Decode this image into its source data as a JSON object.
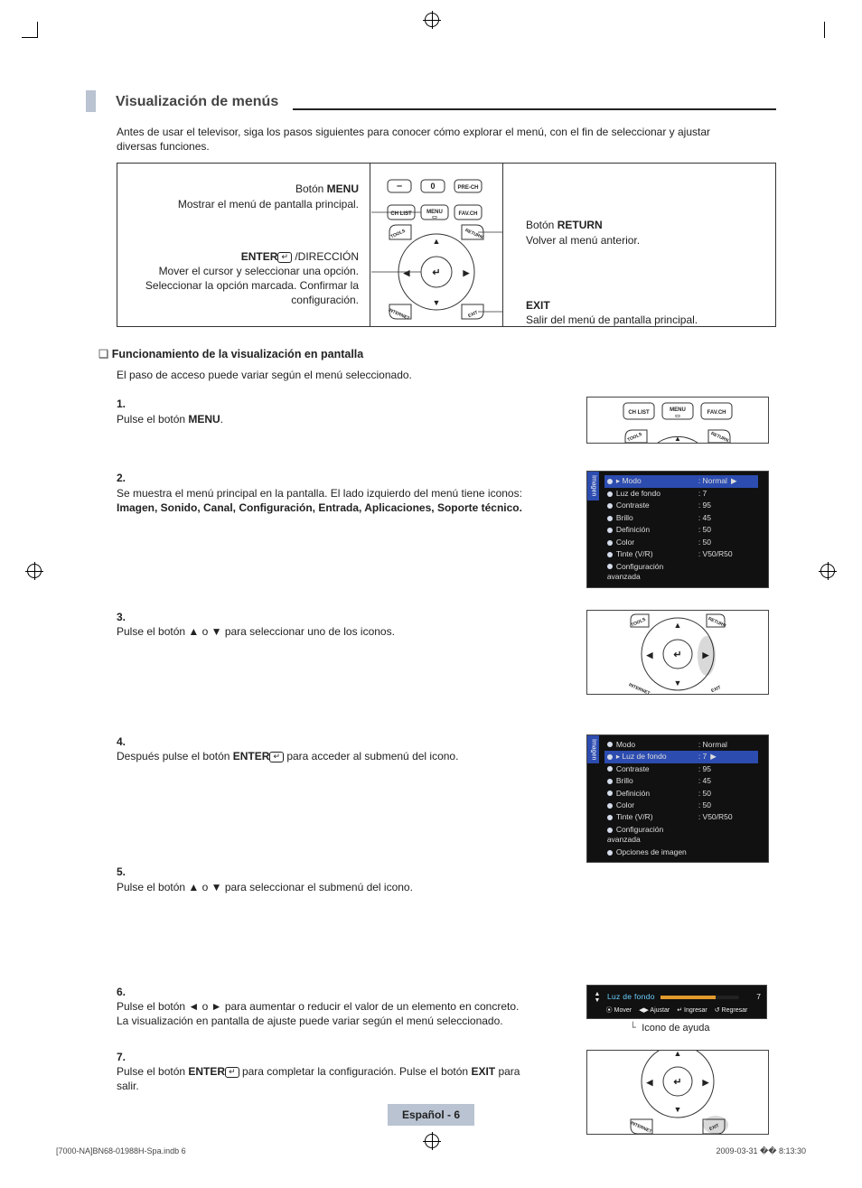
{
  "heading": "Visualización de menús",
  "intro": "Antes de usar el televisor, siga los pasos siguientes para conocer cómo explorar el menú, con el fin de seleccionar y ajustar diversas funciones.",
  "diagram": {
    "menu_btn_label_pre": "Botón ",
    "menu_btn_label_bold": "MENU",
    "menu_btn_desc": "Mostrar el menú de pantalla principal.",
    "enter_label_bold": "ENTER",
    "enter_label_post": " /DIRECCIÓN",
    "enter_desc": "Mover el cursor y seleccionar una opción. Seleccionar la opción marcada. Confirmar la configuración.",
    "return_label_pre": "Botón ",
    "return_label_bold": "RETURN",
    "return_desc": "Volver al menú anterior.",
    "exit_label_bold": "EXIT",
    "exit_desc": "Salir del menú de pantalla principal.",
    "remote_buttons": {
      "minus": "–",
      "zero": "0",
      "prech": "PRE-CH",
      "chlist": "CH LIST",
      "menu": "MENU",
      "favch": "FAV.CH",
      "tools": "TOOLS",
      "return": "RETURN",
      "internet": "INTERNET",
      "exit": "EXIT"
    }
  },
  "sub_heading": "Funcionamiento de la visualización en pantalla",
  "sub_intro": "El paso de acceso puede variar según el menú seleccionado.",
  "steps": {
    "s1": {
      "num": "1.",
      "text_pre": "Pulse el botón ",
      "text_bold": "MENU",
      "text_post": "."
    },
    "s2": {
      "num": "2.",
      "text_a": "Se muestra el menú principal en la pantalla. El lado izquierdo del menú tiene iconos:",
      "text_b_bold": "Imagen, Sonido, Canal, Configuración, Entrada, Aplicaciones, Soporte técnico."
    },
    "s3": {
      "num": "3.",
      "text": "Pulse el botón ▲ o ▼ para seleccionar uno de los iconos."
    },
    "s4": {
      "num": "4.",
      "text_pre": "Después pulse el botón ",
      "text_bold": "ENTER",
      "text_post": " para acceder al submenú del icono."
    },
    "s5": {
      "num": "5.",
      "text": "Pulse el botón ▲ o ▼ para seleccionar el submenú del icono."
    },
    "s6": {
      "num": "6.",
      "text": "Pulse el botón ◄ o ► para aumentar o reducir el valor de un elemento en concreto. La visualización en pantalla de ajuste puede variar según el menú seleccionado."
    },
    "s7": {
      "num": "7.",
      "text_pre": "Pulse el botón ",
      "text_bold_a": "ENTER",
      "text_mid": " para completar la configuración. Pulse el botón ",
      "text_bold_b": "EXIT",
      "text_post": " para salir."
    }
  },
  "osd_tab": "Imagen",
  "osd1": {
    "rows": [
      {
        "k": "Modo",
        "v": ": Normal",
        "hl": true,
        "arr": true
      },
      {
        "k": "Luz de fondo",
        "v": ": 7"
      },
      {
        "k": "Contraste",
        "v": ": 95"
      },
      {
        "k": "Brillo",
        "v": ": 45"
      },
      {
        "k": "Definición",
        "v": ": 50"
      },
      {
        "k": "Color",
        "v": ": 50"
      },
      {
        "k": "Tinte (V/R)",
        "v": ": V50/R50"
      },
      {
        "k": "Configuración avanzada",
        "v": ""
      }
    ]
  },
  "osd2": {
    "rows": [
      {
        "k": "Modo",
        "v": ": Normal"
      },
      {
        "k": "Luz de fondo",
        "v": ": 7",
        "hl": true,
        "arr": true
      },
      {
        "k": "Contraste",
        "v": ": 95"
      },
      {
        "k": "Brillo",
        "v": ": 45"
      },
      {
        "k": "Definición",
        "v": ": 50"
      },
      {
        "k": "Color",
        "v": ": 50"
      },
      {
        "k": "Tinte (V/R)",
        "v": ": V50/R50"
      },
      {
        "k": "Configuración avanzada",
        "v": ""
      },
      {
        "k": "Opciones de imagen",
        "v": ""
      }
    ]
  },
  "slider": {
    "title": "Luz de fondo",
    "value": "7",
    "help": {
      "move": "Mover",
      "adjust": "Ajustar",
      "enter": "Ingresar",
      "return": "Regresar"
    }
  },
  "help_caption": "Icono de ayuda",
  "page_badge": "Español - 6",
  "print_left": "[7000-NA]BN68-01988H-Spa.indb   6",
  "print_right": "2009-03-31   �� 8:13:30"
}
